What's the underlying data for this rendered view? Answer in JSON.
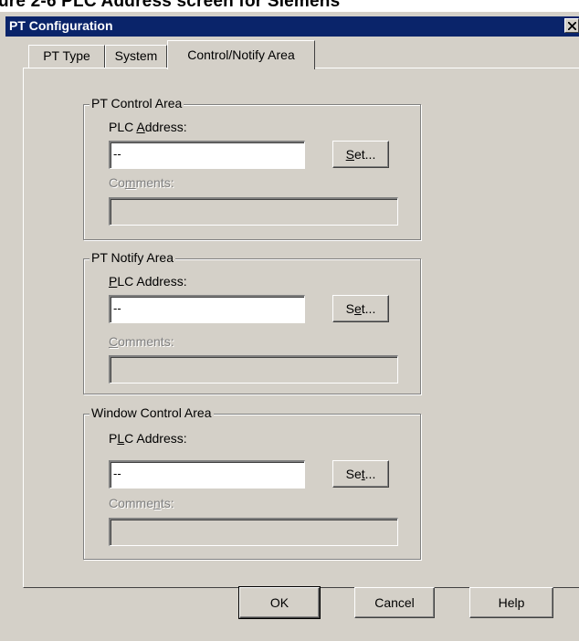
{
  "caption": "ure 2-6 PLC Address screen for Siemens",
  "window": {
    "title": "PT Configuration",
    "close_glyph": "×"
  },
  "tabs": [
    {
      "label": "PT Type",
      "active": false
    },
    {
      "label": "System",
      "active": false
    },
    {
      "label": "Control/Notify Area",
      "active": true
    }
  ],
  "groups": [
    {
      "title": "PT Control Area",
      "plc_label_pre": "PLC ",
      "plc_label_mn": "A",
      "plc_label_post": "ddress:",
      "plc_value": "--",
      "set_pre": "",
      "set_mn": "S",
      "set_post": "et...",
      "comments_pre": "Co",
      "comments_mn": "m",
      "comments_post": "ments:",
      "comments_value": ""
    },
    {
      "title": "PT Notify Area",
      "plc_label_pre": "",
      "plc_label_mn": "P",
      "plc_label_post": "LC Address:",
      "plc_value": "--",
      "set_pre": "S",
      "set_mn": "e",
      "set_post": "t...",
      "comments_pre": "",
      "comments_mn": "C",
      "comments_post": "omments:",
      "comments_value": ""
    },
    {
      "title": "Window Control Area",
      "plc_label_pre": "P",
      "plc_label_mn": "L",
      "plc_label_post": "C Address:",
      "plc_value": "--",
      "set_pre": "Se",
      "set_mn": "t",
      "set_post": "...",
      "comments_pre": "Comme",
      "comments_mn": "n",
      "comments_post": "ts:",
      "comments_value": ""
    }
  ],
  "buttons": {
    "ok": "OK",
    "cancel": "Cancel",
    "help": "Help"
  }
}
